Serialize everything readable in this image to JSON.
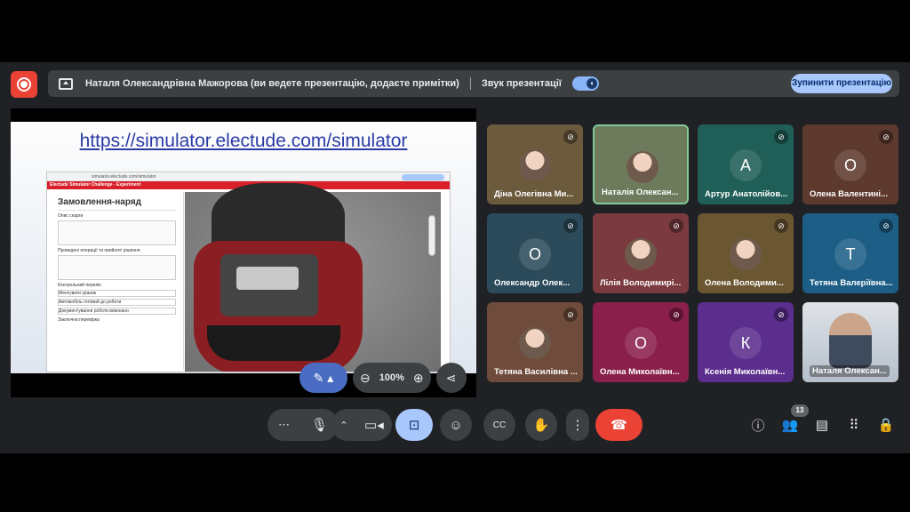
{
  "banner": {
    "presenter_text": "Наталя Олександрівна Мажорова (ви ведете презентацію, додаєте примітки)",
    "sound_label": "Звук презентації",
    "stop_label": "Зупинити презентацію"
  },
  "slide": {
    "url": "https://simulator.electude.com/simulator",
    "browser_address": "simulator.electude.com/simulator",
    "app_bar": "Electude Simulator Challenge - Experiment",
    "order_title": "Замовлення-наряд",
    "task_label": "Опис скарги",
    "ops_label": "Проведені операції та прийняті рішення",
    "control_label": "Контрольний перелік",
    "check1": "Ментувати ураник",
    "check2": "Автомобіль готовий до роботи",
    "check3": "Документування роботи виконано",
    "final_label": "Заключна перевірка"
  },
  "present_controls": {
    "zoom_percent": "100%"
  },
  "participants": [
    {
      "name": "Діна Олегівна Ми...",
      "initial": "",
      "muted": true,
      "color": "#6b5a3c"
    },
    {
      "name": "Наталія Олексан...",
      "initial": "",
      "muted": false,
      "color": "#6e7a5c"
    },
    {
      "name": "Артур Анатолійов...",
      "initial": "А",
      "muted": true,
      "color": "#1f5f57"
    },
    {
      "name": "Олена Валентині...",
      "initial": "О",
      "muted": true,
      "color": "#5e3a2e"
    },
    {
      "name": "Олександр Олек...",
      "initial": "О",
      "muted": true,
      "color": "#2b4a5a"
    },
    {
      "name": "Лілія Володимирі...",
      "initial": "",
      "muted": true,
      "color": "#7a3a3f"
    },
    {
      "name": "Олена Володими...",
      "initial": "",
      "muted": true,
      "color": "#6b5632"
    },
    {
      "name": "Тетяна Валеріївна...",
      "initial": "Т",
      "muted": true,
      "color": "#1d5e86"
    },
    {
      "name": "Тетяна Василівна ...",
      "initial": "",
      "muted": true,
      "color": "#6e4b3a"
    },
    {
      "name": "Олена Миколаївн...",
      "initial": "О",
      "muted": true,
      "color": "#8a1f4b"
    },
    {
      "name": "Ксенія Миколаївн...",
      "initial": "К",
      "muted": true,
      "color": "#5b2d8c"
    },
    {
      "name": "Наталя Олексан...",
      "initial": "",
      "muted": false,
      "color": "#d0d6dc"
    }
  ],
  "people_count": "13",
  "colors": {
    "accent": "#8ab4f8",
    "end_call": "#ea4335",
    "record": "#ea4335",
    "present_active": "#8ab4f8"
  }
}
